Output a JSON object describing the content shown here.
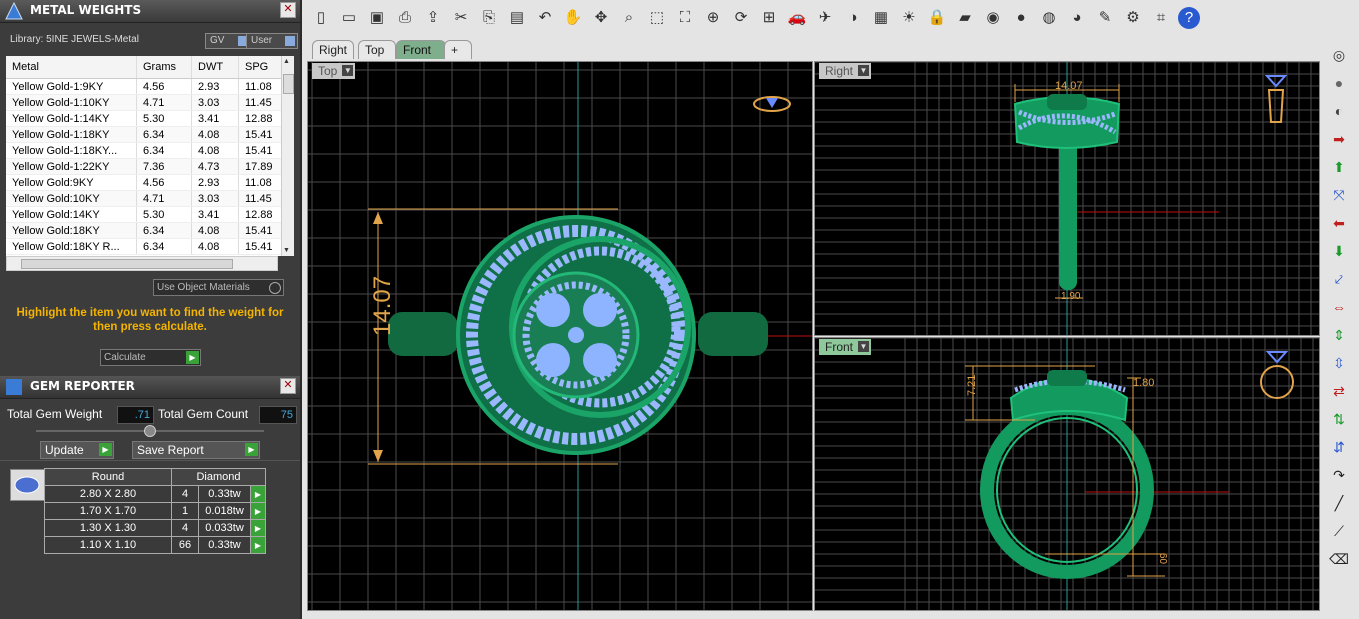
{
  "metal_panel": {
    "title": "METAL WEIGHTS",
    "library": "Library: 5INE JEWELS-Metal",
    "gv_label": "GV",
    "user_label": "User",
    "columns": [
      "Metal",
      "Grams",
      "DWT",
      "SPG"
    ],
    "rows": [
      [
        "Yellow Gold-1:9KY",
        "4.56",
        "2.93",
        "11.08"
      ],
      [
        "Yellow Gold-1:10KY",
        "4.71",
        "3.03",
        "11.45"
      ],
      [
        "Yellow Gold-1:14KY",
        "5.30",
        "3.41",
        "12.88"
      ],
      [
        "Yellow Gold-1:18KY",
        "6.34",
        "4.08",
        "15.41"
      ],
      [
        "Yellow Gold-1:18KY...",
        "6.34",
        "4.08",
        "15.41"
      ],
      [
        "Yellow Gold-1:22KY",
        "7.36",
        "4.73",
        "17.89"
      ],
      [
        "Yellow Gold:9KY",
        "4.56",
        "2.93",
        "11.08"
      ],
      [
        "Yellow Gold:10KY",
        "4.71",
        "3.03",
        "11.45"
      ],
      [
        "Yellow Gold:14KY",
        "5.30",
        "3.41",
        "12.88"
      ],
      [
        "Yellow Gold:18KY",
        "6.34",
        "4.08",
        "15.41"
      ],
      [
        "Yellow Gold:18KY R...",
        "6.34",
        "4.08",
        "15.41"
      ]
    ],
    "use_object_materials": "Use Object Materials",
    "hint": "Highlight the item you want to find the weight for then press calculate.",
    "calculate": "Calculate"
  },
  "gem_panel": {
    "title": "GEM REPORTER",
    "total_weight_label": "Total Gem Weight",
    "total_weight": ".71",
    "total_count_label": "Total Gem Count",
    "total_count": "75",
    "update": "Update",
    "save_report": "Save Report",
    "columns": [
      "Round",
      "Diamond"
    ],
    "rows": [
      [
        "2.80 X 2.80",
        "4",
        "0.33tw"
      ],
      [
        "1.70 X 1.70",
        "1",
        "0.018tw"
      ],
      [
        "1.30 X 1.30",
        "4",
        "0.033tw"
      ],
      [
        "1.10 X 1.10",
        "66",
        "0.33tw"
      ]
    ]
  },
  "tabs": [
    "Right",
    "Top",
    "Front",
    "+"
  ],
  "selected_tab": "Front",
  "viewports": {
    "top": {
      "label": "Top",
      "dim": "14.07"
    },
    "right": {
      "label": "Right",
      "dim_top": "14.07",
      "dim_bottom": "1.90"
    },
    "front": {
      "label": "Front",
      "dim_left": "7.21",
      "dim_right": "1.80",
      "dim_bottom": "09"
    }
  },
  "toolbar_icons": [
    "new-icon",
    "open-icon",
    "save-icon",
    "print-icon",
    "export-icon",
    "cut-icon",
    "copy-icon",
    "paste-icon",
    "undo-icon",
    "pan-icon",
    "move-icon",
    "zoom-icon",
    "zoom-window-icon",
    "zoom-extents-icon",
    "zoom-dynamic-icon",
    "rotate-view-icon",
    "four-view-icon",
    "car-icon",
    "plane-icon",
    "measure-icon",
    "snap-icon",
    "light-icon",
    "lock-icon",
    "layer-icon",
    "color-wheel-icon",
    "sphere-shaded-icon",
    "sphere-wire-icon",
    "sphere-blue-icon",
    "pencil-icon",
    "gear-icon",
    "transform-icon",
    "help-icon"
  ],
  "colors": {
    "ring": "#1f8a5a",
    "gem": "#8fb4ff",
    "dim": "#e2a44a",
    "grid": "#555555"
  }
}
